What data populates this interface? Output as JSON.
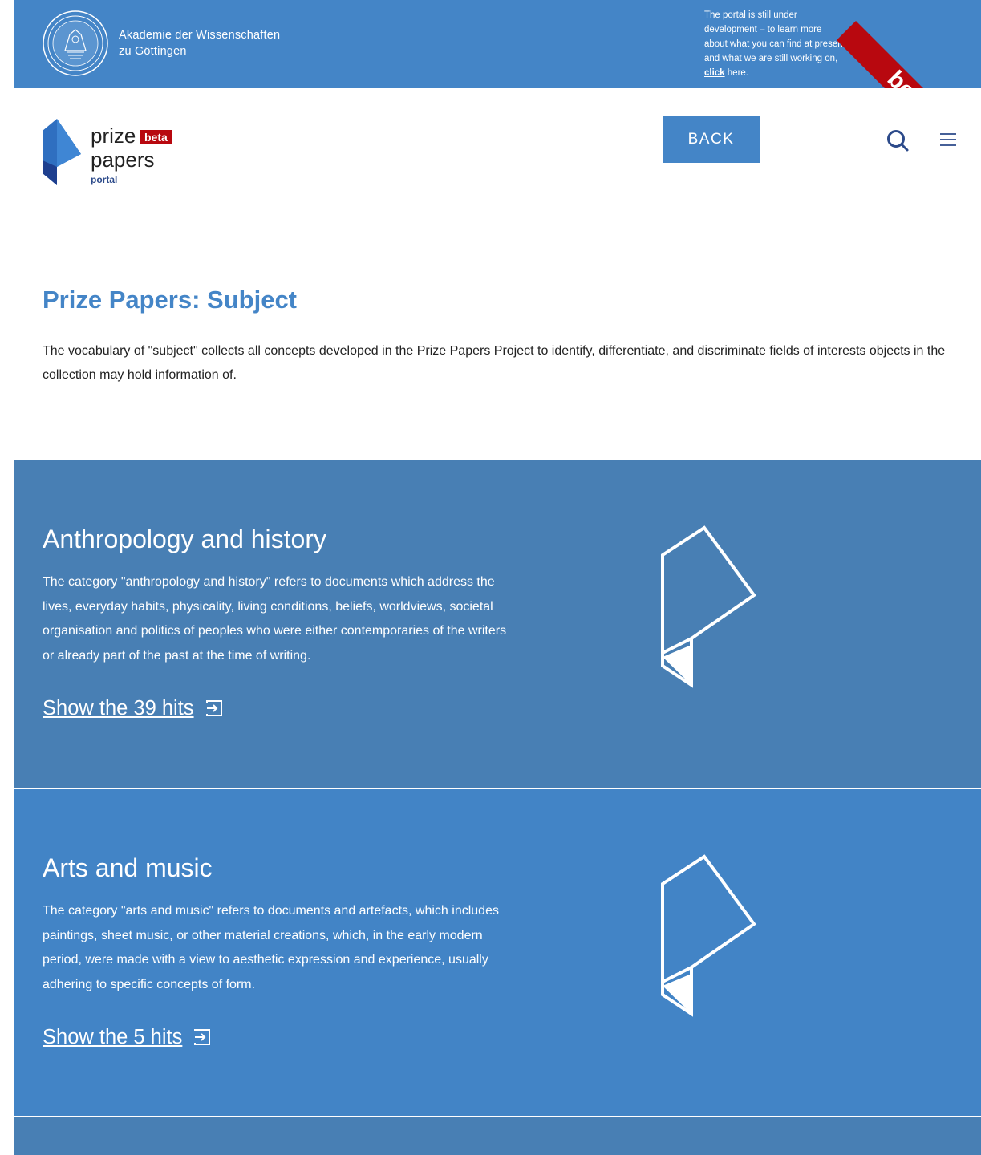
{
  "topbar": {
    "academy_line1": "Akademie der Wissenschaften",
    "academy_line2": "zu Göttingen",
    "notice_line1": "The portal is still under",
    "notice_line2": "development – to learn more",
    "notice_line3": "about what you can find at present",
    "notice_line4": "and what we are still working on,",
    "notice_link": "click",
    "notice_tail": " here.",
    "ribbon": "beta"
  },
  "header": {
    "logo_prize": "prize",
    "logo_beta": "beta",
    "logo_papers": "papers",
    "logo_portal": "portal",
    "back_label": "BACK",
    "search_icon": "search-icon",
    "menu_icon": "hamburger-menu-icon"
  },
  "main": {
    "title": "Prize Papers: Subject",
    "intro": "The vocabulary of \"subject\" collects all concepts developed in the Prize Papers Project to identify, differentiate, and discriminate fields of interests objects in the collection may hold information of."
  },
  "categories": [
    {
      "title": "Anthropology and history",
      "description": "The category \"anthropology and history\" refers to documents which address the lives, everyday habits, physicality, living conditions, beliefs, worldviews, societal organisation and politics of peoples who were either contemporaries of the writers or already part of the past at the time of writing.",
      "link": "Show the 39 hits"
    },
    {
      "title": "Arts and music",
      "description": "The category \"arts and music\" refers to documents and artefacts, which includes paintings, sheet music, or other material creations, which, in the early modern period, were made with a view to aesthetic expression and experience, usually adhering to specific concepts of form.",
      "link": "Show the 5 hits"
    }
  ],
  "colors": {
    "primary": "#4485c7",
    "section_dark": "#487fb4",
    "beta_red": "#b8080f",
    "logo_text_blue": "#2c4a8a"
  }
}
